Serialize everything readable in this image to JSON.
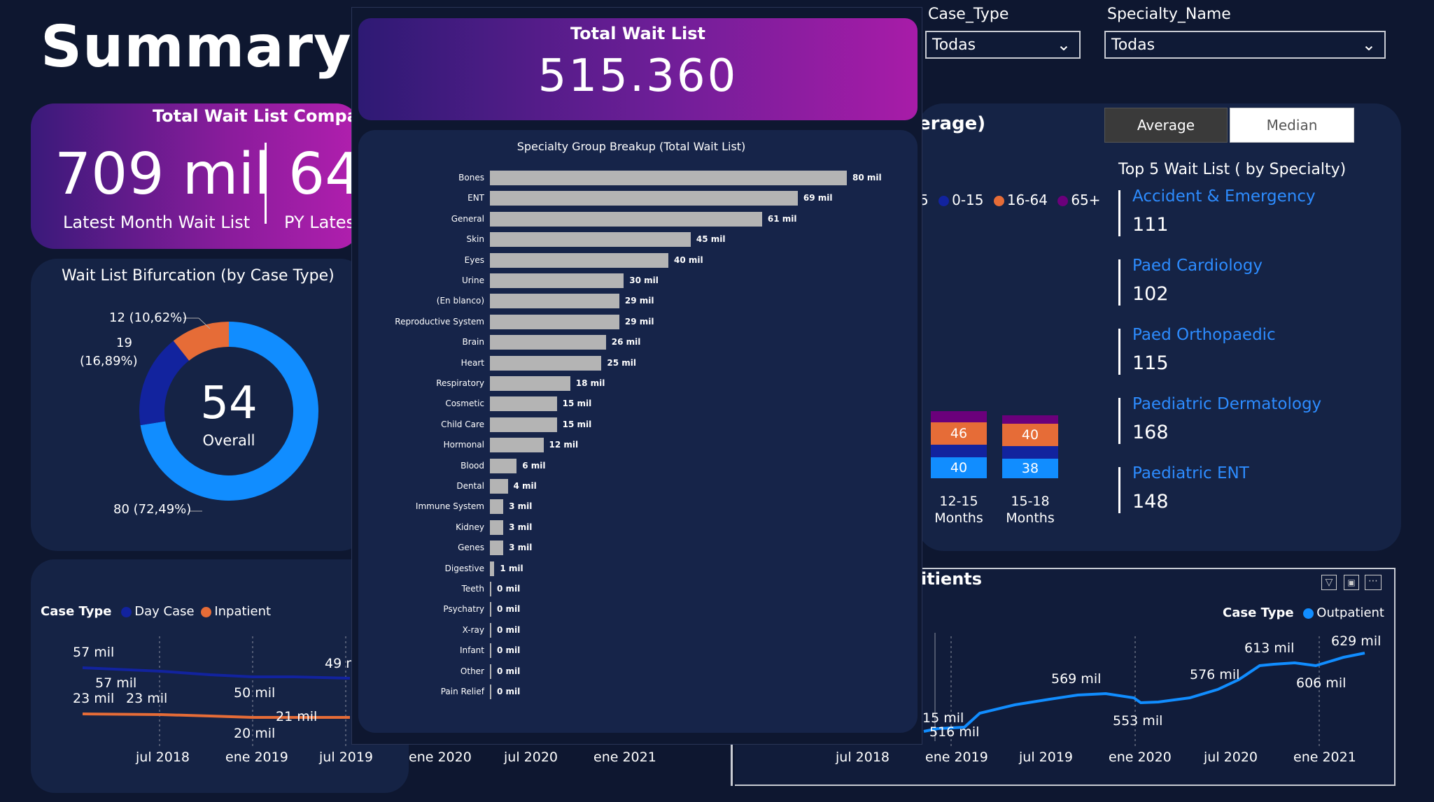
{
  "page_title": "Summary",
  "filters": {
    "case_type": {
      "label": "Case_Type",
      "value": "Todas"
    },
    "specialty": {
      "label": "Specialty_Name",
      "value": "Todas"
    }
  },
  "comparison": {
    "title": "Total Wait List Comparis",
    "latest_value": "709 mil",
    "latest_label": "Latest Month Wait List",
    "py_value": "64",
    "py_label": "PY Lates"
  },
  "total_wait": {
    "title": "Total Wait List",
    "value": "515.360"
  },
  "donut": {
    "title": "Wait List Bifurcation (by Case Type)",
    "center_value": "54",
    "center_label": "Overall",
    "label_a": "12 (10,62%)",
    "label_b1": "19",
    "label_b2": "(16,89%)",
    "label_c": "80 (72,49%)",
    "segments": [
      {
        "value": 72.49,
        "color": "#118dff"
      },
      {
        "value": 16.89,
        "color": "#12239e"
      },
      {
        "value": 10.62,
        "color": "#e66c37"
      }
    ]
  },
  "age_section": {
    "title_fragment": "erage)",
    "toggle": {
      "average": "Average",
      "median": "Median"
    },
    "legend_prefix": "5",
    "legend": [
      {
        "label": "0-15",
        "color": "#12239e"
      },
      {
        "label": "16-64",
        "color": "#e66c37"
      },
      {
        "label": "65+",
        "color": "#6b007b"
      }
    ],
    "bars": [
      {
        "orange": "46",
        "blue": "40",
        "x1": "12-15",
        "x2": "Months"
      },
      {
        "orange": "40",
        "blue": "38",
        "x1": "15-18",
        "x2": "Months"
      }
    ]
  },
  "top5": {
    "title": "Top 5 Wait List ( by Specialty)",
    "items": [
      {
        "name": "Accident & Emergency",
        "value": "111"
      },
      {
        "name": "Paed Cardiology",
        "value": "102"
      },
      {
        "name": "Paed Orthopaedic",
        "value": "115"
      },
      {
        "name": "Paediatric Dermatology",
        "value": "168"
      },
      {
        "name": "Paediatric ENT",
        "value": "148"
      }
    ]
  },
  "line_left": {
    "legend_title": "Case Type",
    "legend": [
      {
        "label": "Day Case",
        "color": "#12239e"
      },
      {
        "label": "Inpatient",
        "color": "#e66c37"
      }
    ],
    "labels": [
      "57 mil",
      "57 mil",
      "23 mil",
      "23 mil",
      "50 mil",
      "49 m",
      "21 mil",
      "20 mil"
    ],
    "x_ticks": [
      "jul 2018",
      "ene 2019",
      "jul 2019",
      "ene 2020",
      "jul 2020",
      "ene 2021"
    ]
  },
  "line_right": {
    "title_fragment": "itients",
    "legend_title": "Case Type",
    "legend": [
      {
        "label": "Outpatient",
        "color": "#118dff"
      }
    ],
    "labels": [
      "15 mil",
      "516 mil",
      "569 mil",
      "553 mil",
      "576 mil",
      "613 mil",
      "606 mil",
      "629 mil"
    ],
    "x_ticks": [
      "jul 2018",
      "ene 2019",
      "jul 2019",
      "ene 2020",
      "jul 2020",
      "ene 2021"
    ]
  },
  "chart_data": {
    "type": "bar",
    "title": "Specialty Group Breakup (Total Wait List)",
    "categories": [
      "Bones",
      "ENT",
      "General",
      "Skin",
      "Eyes",
      "Urine",
      "(En blanco)",
      "Reproductive System",
      "Brain",
      "Heart",
      "Respiratory",
      "Cosmetic",
      "Child Care",
      "Hormonal",
      "Blood",
      "Dental",
      "Immune System",
      "Kidney",
      "Genes",
      "Digestive",
      "Teeth",
      "Psychatry",
      "X-ray",
      "Infant",
      "Other",
      "Pain Relief"
    ],
    "values": [
      80,
      69,
      61,
      45,
      40,
      30,
      29,
      29,
      26,
      25,
      18,
      15,
      15,
      12,
      6,
      4,
      3,
      3,
      3,
      1,
      0,
      0,
      0,
      0,
      0,
      0
    ],
    "value_labels": [
      "80 mil",
      "69 mil",
      "61 mil",
      "45 mil",
      "40 mil",
      "30 mil",
      "29 mil",
      "29 mil",
      "26 mil",
      "25 mil",
      "18 mil",
      "15 mil",
      "15 mil",
      "12 mil",
      "6 mil",
      "4 mil",
      "3 mil",
      "3 mil",
      "3 mil",
      "1 mil",
      "0 mil",
      "0 mil",
      "0 mil",
      "0 mil",
      "0 mil",
      "0 mil"
    ],
    "xlim": [
      0,
      80
    ],
    "unit": "mil",
    "bar_color": "#b4b4b4"
  }
}
